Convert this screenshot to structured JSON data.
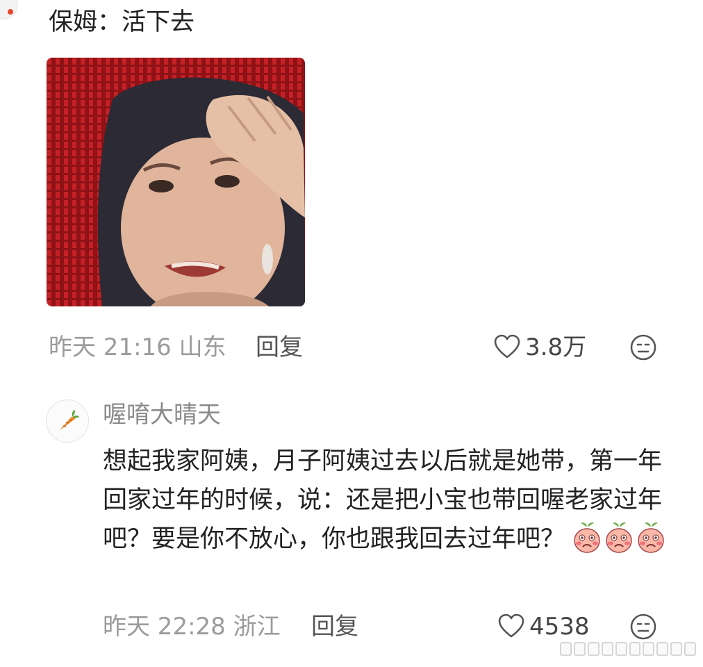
{
  "comment1": {
    "text": "保姆：活下去",
    "time_location": "昨天 21:16 山东",
    "reply_label": "回复",
    "like_count": "3.8万",
    "image_icon": "meme-image"
  },
  "comment2": {
    "username": "喔唷大晴天",
    "avatar_icon": "carrot-icon",
    "text": "想起我家阿姨，月子阿姨过去以后就是她带，第一年回家过年的时候，说：还是把小宝也带回喔老家过年吧？要是你不放心，你也跟我回去过年吧？",
    "emoji_icons": [
      "peach-shy-emoji",
      "peach-shy-emoji",
      "peach-shy-emoji"
    ],
    "time_location": "昨天 22:28 浙江",
    "reply_label": "回复",
    "like_count": "4538"
  },
  "colors": {
    "meta_gray": "#9b9b9b",
    "username_gray": "#8a8a8a",
    "text": "#222222"
  }
}
